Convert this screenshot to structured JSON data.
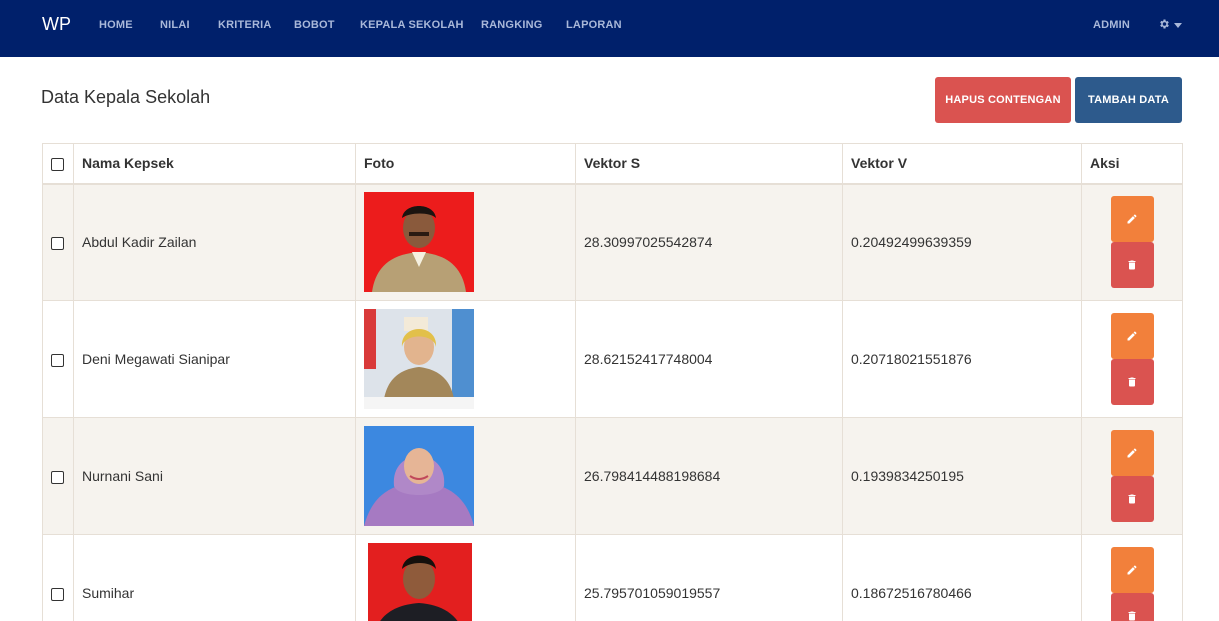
{
  "navbar": {
    "brand": "WP",
    "items": [
      "HOME",
      "NILAI",
      "KRITERIA",
      "BOBOT",
      "KEPALA SEKOLAH",
      "RANGKING",
      "LAPORAN"
    ],
    "user": "ADMIN"
  },
  "page": {
    "title": "Data Kepala Sekolah",
    "delete_button": "HAPUS CONTENGAN",
    "add_button": "TAMBAH DATA"
  },
  "table": {
    "headers": {
      "name": "Nama Kepsek",
      "foto": "Foto",
      "vs": "Vektor S",
      "vv": "Vektor V",
      "aksi": "Aksi"
    },
    "rows": [
      {
        "name": "Abdul Kadir Zailan",
        "vs": "28.30997025542874",
        "vv": "0.20492499639359",
        "photo_bg": "#ec1c1c"
      },
      {
        "name": "Deni Megawati Sianipar",
        "vs": "28.62152417748004",
        "vv": "0.20718021551876",
        "photo_bg": "#dde3ea"
      },
      {
        "name": "Nurnani Sani",
        "vs": "26.798414488198684",
        "vv": "0.1939834250195",
        "photo_bg": "#3c88e0"
      },
      {
        "name": "Sumihar",
        "vs": "25.795701059019557",
        "vv": "0.18672516780466",
        "photo_bg": "#e31f1f"
      }
    ]
  },
  "colors": {
    "navbar": "#00206b",
    "danger": "#da5350",
    "primary": "#2d5a8c",
    "warning": "#f2803b"
  }
}
